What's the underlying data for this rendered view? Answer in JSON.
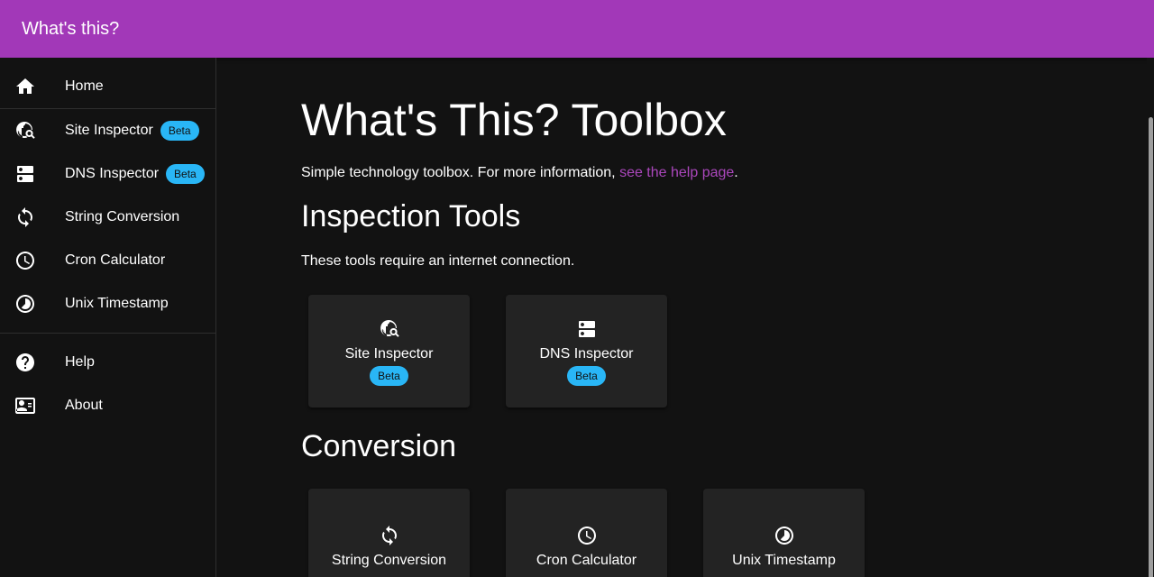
{
  "appbar": {
    "title": "What's this?"
  },
  "sidebar": {
    "items": [
      {
        "label": "Home",
        "icon": "home-icon"
      },
      {
        "label": "Site Inspector",
        "icon": "site-inspector-icon",
        "badge": "Beta"
      },
      {
        "label": "DNS Inspector",
        "icon": "dns-icon",
        "badge": "Beta"
      },
      {
        "label": "String Conversion",
        "icon": "sync-icon"
      },
      {
        "label": "Cron Calculator",
        "icon": "clock-icon"
      },
      {
        "label": "Unix Timestamp",
        "icon": "timelapse-icon"
      }
    ],
    "secondary": [
      {
        "label": "Help",
        "icon": "help-icon"
      },
      {
        "label": "About",
        "icon": "about-icon"
      }
    ]
  },
  "main": {
    "title": "What's This? Toolbox",
    "intro_text": "Simple technology toolbox. For more information, ",
    "intro_link": "see the help page",
    "intro_end": ".",
    "sections": [
      {
        "heading": "Inspection Tools",
        "description": "These tools require an internet connection.",
        "cards": [
          {
            "label": "Site Inspector",
            "badge": "Beta",
            "icon": "site-inspector-icon"
          },
          {
            "label": "DNS Inspector",
            "badge": "Beta",
            "icon": "dns-icon"
          }
        ]
      },
      {
        "heading": "Conversion",
        "cards": [
          {
            "label": "String Conversion",
            "icon": "sync-icon"
          },
          {
            "label": "Cron Calculator",
            "icon": "clock-icon"
          },
          {
            "label": "Unix Timestamp",
            "icon": "timelapse-icon"
          }
        ]
      }
    ]
  },
  "colors": {
    "appbar": "#a238b8",
    "link": "#ab47bc",
    "badge": "#29b6f6",
    "background": "#121212",
    "card": "#232323"
  }
}
